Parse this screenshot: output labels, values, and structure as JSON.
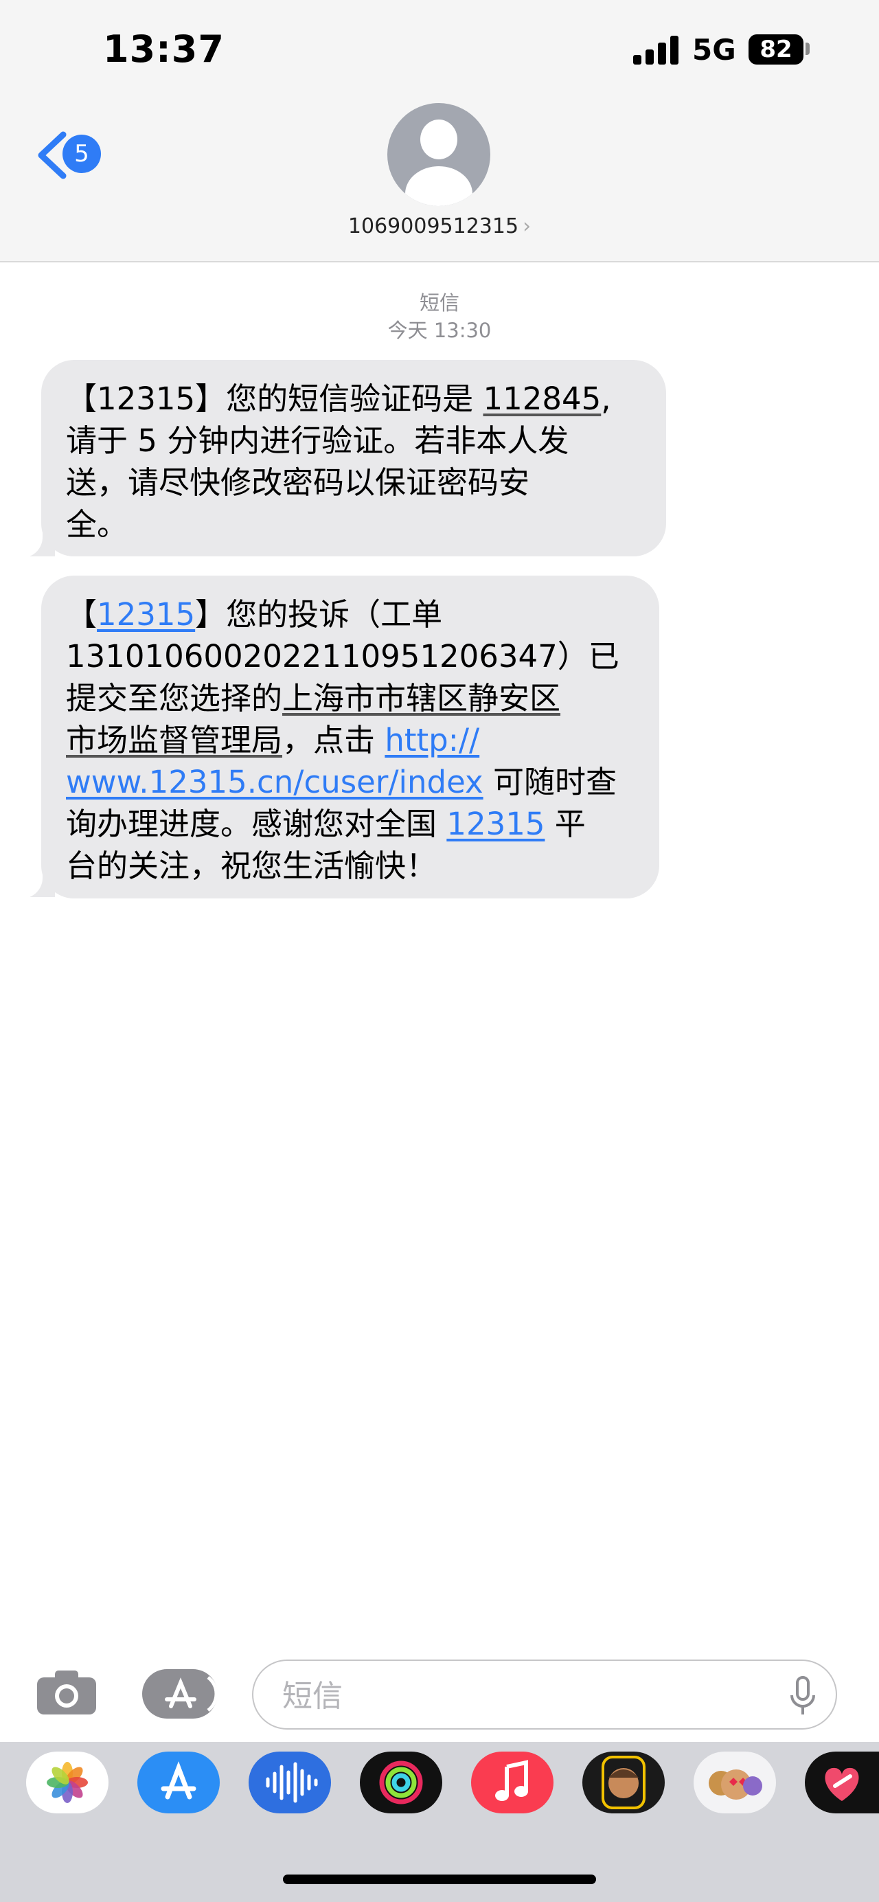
{
  "status": {
    "time": "13:37",
    "network": "5G",
    "battery": "82"
  },
  "header": {
    "back_badge": "5",
    "contact": "1069009512315",
    "chevron": "›"
  },
  "thread": {
    "meta_type": "短信",
    "meta_time": "今天 13:30"
  },
  "messages": [
    {
      "lines": [
        [
          "【12315】您的短信验证码是 ",
          "112845",
          ","
        ],
        [
          "请于 5 分钟内进行验证。若非本人发"
        ],
        [
          "送，请尽快修改密码以保证密码安"
        ],
        [
          "全。"
        ]
      ]
    },
    {
      "l1a": "【",
      "l1link": "12315",
      "l1b": "】您的投诉（工单",
      "l2a": "13101060020221109512063​47",
      "l2b": "）已",
      "l3a": "提交至您选择的",
      "l3u": "上海市市辖区静安区",
      "l4u": "市场监督管理局",
      "l4a": "，点击 ",
      "l4link": "http://",
      "l5link": "www.12315.cn/cuser/index",
      "l5a": " 可随时查",
      "l6a": "询办理进度。感谢您对全国 ",
      "l6link": "12315",
      "l6b": " 平",
      "l7a": "台的关注，祝您生活愉快！"
    }
  ],
  "composer": {
    "placeholder": "短信"
  },
  "apps": [
    "photos-app-icon",
    "app-store-app-icon",
    "audio-app-icon",
    "fitness-app-icon",
    "music-app-icon",
    "memoji-app-icon",
    "memoji-stickers-app-icon",
    "heart-app-icon"
  ],
  "colors": {
    "link": "#2f7cf6",
    "bubble": "#e9e9eb",
    "header": "#f5f5f5"
  }
}
